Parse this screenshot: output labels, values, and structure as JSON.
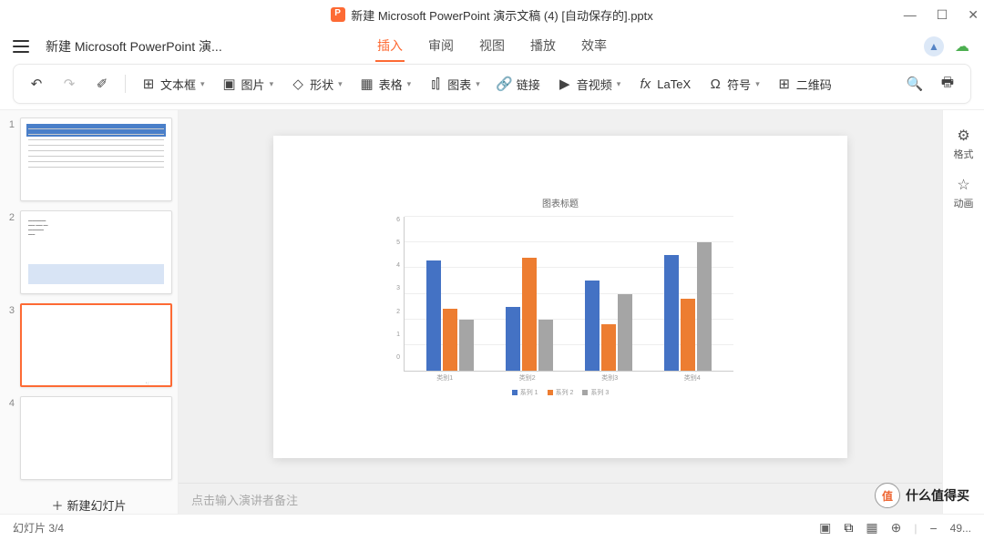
{
  "titlebar": {
    "title": "新建 Microsoft PowerPoint 演示文稿 (4) [自动保存的].pptx"
  },
  "context_name": "新建 Microsoft PowerPoint 演...",
  "tabs": [
    "插入",
    "审阅",
    "视图",
    "播放",
    "效率"
  ],
  "active_tab_index": 0,
  "toolbar": {
    "textbox": "文本框",
    "image": "图片",
    "shape": "形状",
    "table": "表格",
    "chart": "图表",
    "link": "链接",
    "media": "音视频",
    "latex": "LaTeX",
    "symbol": "符号",
    "qrcode": "二维码"
  },
  "side": {
    "format": "格式",
    "animate": "动画"
  },
  "notes_placeholder": "点击输入演讲者备注",
  "new_slide": "新建幻灯片",
  "status": {
    "counter": "幻灯片 3/4",
    "zoom": "49..."
  },
  "thumb_nums": [
    "1",
    "2",
    "3",
    "4"
  ],
  "chart_data": {
    "type": "bar",
    "title": "图表标题",
    "categories": [
      "类别1",
      "类别2",
      "类别3",
      "类别4"
    ],
    "series": [
      {
        "name": "系列 1",
        "color": "#4472c4",
        "values": [
          4.3,
          2.5,
          3.5,
          4.5
        ]
      },
      {
        "name": "系列 2",
        "color": "#ed7d31",
        "values": [
          2.4,
          4.4,
          1.8,
          2.8
        ]
      },
      {
        "name": "系列 3",
        "color": "#a5a5a5",
        "values": [
          2.0,
          2.0,
          3.0,
          5.0
        ]
      }
    ],
    "y_ticks": [
      0,
      1,
      2,
      3,
      4,
      5,
      6
    ],
    "ymax": 6
  },
  "watermark": "什么值得买"
}
